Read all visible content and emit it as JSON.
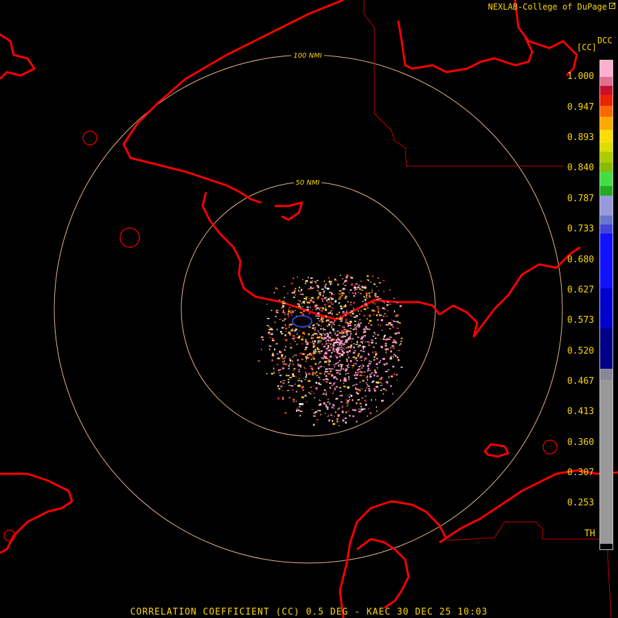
{
  "header": {
    "credit": "NEXLAB-College of DuPage",
    "credit_icon": "external-link-icon"
  },
  "legend": {
    "title": "DCC",
    "unit": "[CC]",
    "ticks": [
      "1.000",
      "0.947",
      "0.893",
      "0.840",
      "0.787",
      "0.733",
      "0.680",
      "0.627",
      "0.573",
      "0.520",
      "0.467",
      "0.413",
      "0.360",
      "0.307",
      "0.253",
      "TH"
    ],
    "colors": [
      "#ffaacc",
      "#cc6688",
      "#cc0022",
      "#ff4400",
      "#ff9900",
      "#ffdd00",
      "#aacc00",
      "#44cc44",
      "#8888cc",
      "#2222ee",
      "#111199",
      "#888888",
      "#000000"
    ]
  },
  "rings": {
    "inner_label": "50 NMI",
    "outer_label": "100 NMI"
  },
  "product": {
    "label": "CORRELATION COEFFICIENT (CC) 0.5 DEG - KAEC 30 DEC 25 10:03"
  },
  "colors": {
    "coast": "#ff0000",
    "ring": "#e8b88a",
    "text": "#ffd800"
  }
}
